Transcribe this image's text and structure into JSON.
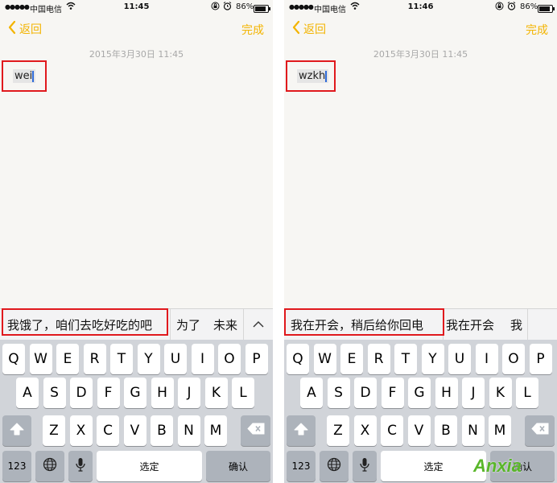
{
  "screens": [
    {
      "status": {
        "signal": "●●●●●",
        "carrier": "中国电信",
        "wifi": "WiFi",
        "time": "11:45",
        "battery_pct": "86%"
      },
      "nav": {
        "back": "返回",
        "done": "完成"
      },
      "date_stamp": "2015年3月30日 11:45",
      "typed_text": "wei",
      "candidates": [
        "我饿了，咱们去吃好吃的吧",
        "为了",
        "未来"
      ],
      "collapse_icon": "^",
      "keys": {
        "row1": [
          "Q",
          "W",
          "E",
          "R",
          "T",
          "Y",
          "U",
          "I",
          "O",
          "P"
        ],
        "row2": [
          "A",
          "S",
          "D",
          "F",
          "G",
          "H",
          "J",
          "K",
          "L"
        ],
        "row3": [
          "Z",
          "X",
          "C",
          "V",
          "B",
          "N",
          "M"
        ],
        "num": "123",
        "space": "选定",
        "return": "确认"
      }
    },
    {
      "status": {
        "signal": "●●●●●",
        "carrier": "中国电信",
        "wifi": "WiFi",
        "time": "11:46",
        "battery_pct": "86%"
      },
      "nav": {
        "back": "返回",
        "done": "完成"
      },
      "date_stamp": "2015年3月30日 11:45",
      "typed_text": "wzkh",
      "candidates": [
        "我在开会，稍后给你回电",
        "我在开会",
        "我"
      ],
      "keys": {
        "row1": [
          "Q",
          "W",
          "E",
          "R",
          "T",
          "Y",
          "U",
          "I",
          "O",
          "P"
        ],
        "row2": [
          "A",
          "S",
          "D",
          "F",
          "G",
          "H",
          "J",
          "K",
          "L"
        ],
        "row3": [
          "Z",
          "X",
          "C",
          "V",
          "B",
          "N",
          "M"
        ],
        "num": "123",
        "space": "选定",
        "return": "确认"
      }
    }
  ],
  "watermark": "Anxia",
  "icons": {
    "back": "chevron-left-icon",
    "shift": "shift-arrow-icon",
    "delete": "delete-backspace-icon",
    "globe": "globe-icon",
    "mic": "microphone-icon"
  },
  "colors": {
    "accent": "#f3b400",
    "highlight_box": "#e0191d",
    "keyboard_bg": "#d1d4d9",
    "cursor": "#2f6bd8"
  }
}
